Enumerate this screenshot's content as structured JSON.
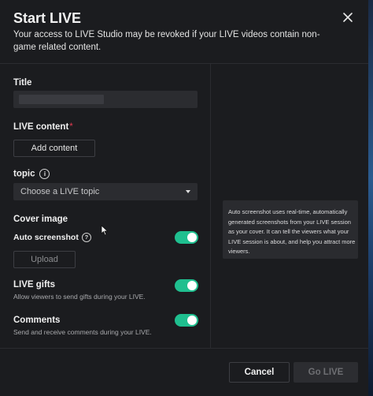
{
  "dialog": {
    "title": "Start LIVE",
    "subtitle": "Your access to LIVE Studio may be revoked if your LIVE videos contain non-game related content.",
    "close_icon": "close-icon"
  },
  "form": {
    "title_label": "Title",
    "title_value": "",
    "live_content_label": "LIVE content",
    "required_mark": "*",
    "add_content_button": "Add content",
    "topic_label": "topic",
    "topic_info_icon": "info-icon",
    "topic_placeholder": "Choose a LIVE topic",
    "cover_image_label": "Cover image",
    "auto_screenshot_label": "Auto screenshot",
    "auto_screenshot_help_icon": "help-icon",
    "auto_screenshot_on": true,
    "upload_button": "Upload",
    "live_gifts_label": "LIVE gifts",
    "live_gifts_desc": "Allow viewers to send gifts during your LIVE.",
    "live_gifts_on": true,
    "comments_label": "Comments",
    "comments_desc": "Send and receive comments during your LIVE.",
    "comments_on": true
  },
  "tooltip": {
    "text": "Auto screenshot uses real-time, automatically generated screenshots from your LIVE session as your cover. It can tell the viewers what your LIVE session is about, and help you attract more viewers."
  },
  "footer": {
    "cancel_button": "Cancel",
    "go_live_button": "Go LIVE"
  },
  "colors": {
    "toggle_on": "#1fbf8f",
    "background": "#1b1c1f",
    "required": "#e0394f"
  }
}
